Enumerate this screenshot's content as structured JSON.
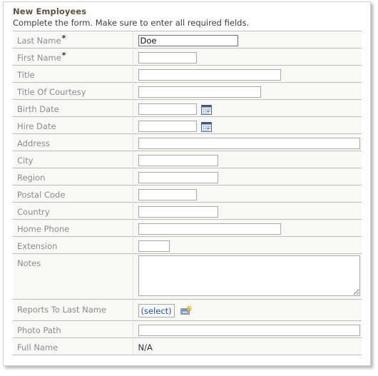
{
  "header": {
    "title": "New Employees",
    "subtitle": "Complete the form. Make sure to enter all required fields."
  },
  "colors": {
    "title": "#5b5441",
    "label": "#8c8c8c",
    "link": "#2255aa",
    "row_bg": "#f8f8f6",
    "border": "#bdbdb8"
  },
  "form": {
    "required_marker": "*",
    "fields": [
      {
        "label": "Last Name",
        "required": true,
        "type": "text",
        "value": "Doe",
        "placeholder": "",
        "width": "w-lg",
        "focused": true
      },
      {
        "label": "First Name",
        "required": true,
        "type": "text",
        "value": "",
        "placeholder": "",
        "width": "w-sm",
        "focused": false
      },
      {
        "label": "Title",
        "required": false,
        "type": "text",
        "value": "",
        "placeholder": "",
        "width": "w-xxl",
        "focused": false
      },
      {
        "label": "Title Of Courtesy",
        "required": false,
        "type": "text",
        "value": "",
        "placeholder": "",
        "width": "w-xl",
        "focused": false
      },
      {
        "label": "Birth Date",
        "required": false,
        "type": "date",
        "value": "",
        "placeholder": "",
        "width": "w-sm",
        "focused": false,
        "icon": "calendar-icon"
      },
      {
        "label": "Hire Date",
        "required": false,
        "type": "date",
        "value": "",
        "placeholder": "",
        "width": "w-sm",
        "focused": false,
        "icon": "calendar-icon"
      },
      {
        "label": "Address",
        "required": false,
        "type": "text",
        "value": "",
        "placeholder": "",
        "width": "w-full",
        "focused": false
      },
      {
        "label": "City",
        "required": false,
        "type": "text",
        "value": "",
        "placeholder": "",
        "width": "w-md",
        "focused": false
      },
      {
        "label": "Region",
        "required": false,
        "type": "text",
        "value": "",
        "placeholder": "",
        "width": "w-md",
        "focused": false
      },
      {
        "label": "Postal Code",
        "required": false,
        "type": "text",
        "value": "",
        "placeholder": "",
        "width": "w-sm",
        "focused": false
      },
      {
        "label": "Country",
        "required": false,
        "type": "text",
        "value": "",
        "placeholder": "",
        "width": "w-md",
        "focused": false
      },
      {
        "label": "Home Phone",
        "required": false,
        "type": "text",
        "value": "",
        "placeholder": "",
        "width": "w-xxl",
        "focused": false
      },
      {
        "label": "Extension",
        "required": false,
        "type": "text",
        "value": "",
        "placeholder": "",
        "width": "w-xs",
        "focused": false
      },
      {
        "label": "Notes",
        "required": false,
        "type": "textarea",
        "value": "",
        "placeholder": "",
        "focused": false
      },
      {
        "label": "Reports To Last Name",
        "required": false,
        "type": "lookup",
        "select_label": "(select)",
        "icon": "lookup-picker-icon"
      },
      {
        "label": "Photo Path",
        "required": false,
        "type": "text",
        "value": "",
        "placeholder": "",
        "width": "w-full",
        "focused": false
      },
      {
        "label": "Full Name",
        "required": false,
        "type": "readonly",
        "value": "N/A"
      }
    ]
  }
}
